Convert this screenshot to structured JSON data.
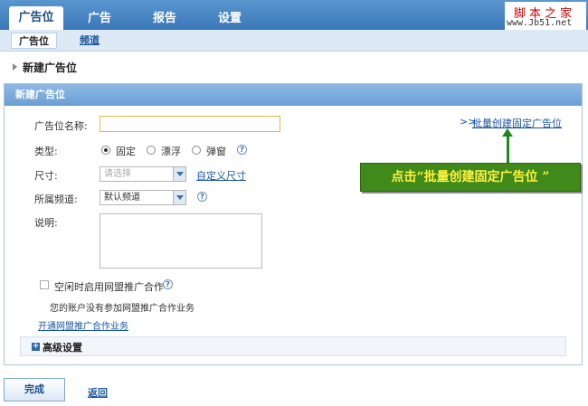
{
  "topnav": {
    "tabs": [
      {
        "label": "广告位",
        "active": true
      },
      {
        "label": "广告",
        "active": false
      },
      {
        "label": "报告",
        "active": false
      },
      {
        "label": "设置",
        "active": false
      }
    ]
  },
  "brand": {
    "line1": "脚本之家",
    "line2": "www.Jb51.net"
  },
  "subnav": {
    "active": "广告位",
    "link": "频道"
  },
  "breadcrumb": "新建广告位",
  "panel": {
    "title": "新建广告位",
    "name_label": "广告位名称:",
    "name_value": "",
    "batch_prefix": ">>",
    "batch_link": "批量创建固定广告位",
    "type_label": "类型:",
    "type_options": [
      "固定",
      "漂浮",
      "弹窗"
    ],
    "type_selected": "固定",
    "size_label": "尺寸:",
    "size_placeholder": "请选择",
    "custom_size_link": "自定义尺寸",
    "channel_label": "所属频道:",
    "channel_value": "默认频道",
    "desc_label": "说明:",
    "desc_value": "",
    "alliance_checkbox_label": "空闲时启用网盟推广合作",
    "alliance_checked": false,
    "alliance_note": "您的账户没有参加网盟推广合作业务",
    "alliance_link": "开通网盟推广合作业务",
    "advanced_label": "高级设置"
  },
  "callout": "点击“批量创建固定广告位 ”",
  "actions": {
    "done": "完成",
    "back": "返回"
  },
  "colors": {
    "nav": "#3a77b8",
    "callout_bg": "#3f8a1a",
    "callout_text": "#fff23d",
    "link": "#1a56a0"
  }
}
